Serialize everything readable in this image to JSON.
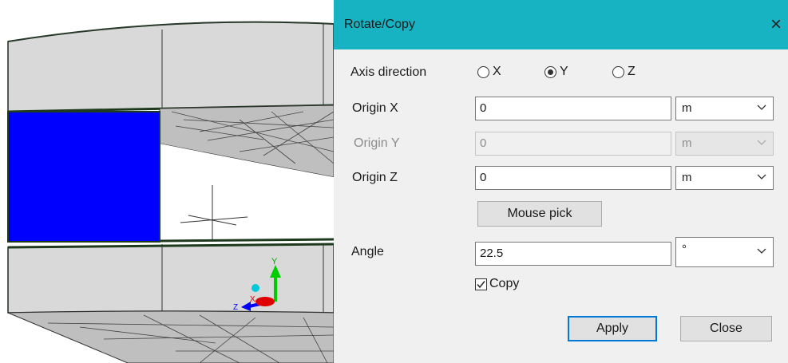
{
  "dialog": {
    "title": "Rotate/Copy",
    "close_glyph": "×",
    "axis_direction_label": "Axis direction",
    "axis_options": [
      {
        "label": "X",
        "selected": false
      },
      {
        "label": "Y",
        "selected": true
      },
      {
        "label": "Z",
        "selected": false
      }
    ],
    "origin_x": {
      "label": "Origin X",
      "value": "0",
      "unit": "m",
      "enabled": true
    },
    "origin_y": {
      "label": "Origin Y",
      "value": "0",
      "unit": "m",
      "enabled": false
    },
    "origin_z": {
      "label": "Origin Z",
      "value": "0",
      "unit": "m",
      "enabled": true
    },
    "mouse_pick_label": "Mouse pick",
    "angle": {
      "label": "Angle",
      "value": "22.5",
      "unit": "°"
    },
    "copy": {
      "label": "Copy",
      "checked": true
    },
    "apply_label": "Apply",
    "close_label": "Close"
  },
  "viewport": {
    "axis_labels": {
      "x": "X",
      "y": "Y",
      "z": "Z"
    },
    "colors": {
      "selected_face": "#0000ff",
      "model_face": "#d9d9d9",
      "axis_x": "#e00000",
      "axis_y": "#00cc00",
      "axis_z": "#0000ff",
      "pivot": "#00c8d8"
    }
  },
  "colors": {
    "title_bar": "#17b3c3",
    "dialog_bg": "#f0f0f0",
    "primary_button_border": "#0078d7"
  }
}
